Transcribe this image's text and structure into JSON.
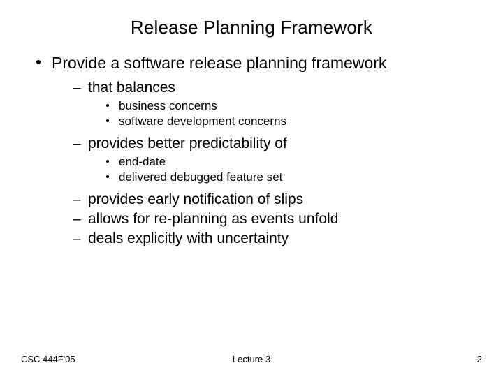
{
  "title": "Release Planning Framework",
  "main_point": "Provide a software release planning framework",
  "subs": [
    {
      "text": "that balances",
      "items": [
        "business concerns",
        "software development concerns"
      ]
    },
    {
      "text": "provides better predictability of",
      "items": [
        "end-date",
        "delivered debugged feature set"
      ]
    },
    {
      "text": "provides early notification of slips"
    },
    {
      "text": "allows for re-planning as events unfold"
    },
    {
      "text": "deals explicitly with uncertainty"
    }
  ],
  "footer": {
    "left": "CSC 444F'05",
    "center": "Lecture 3",
    "right": "2"
  }
}
